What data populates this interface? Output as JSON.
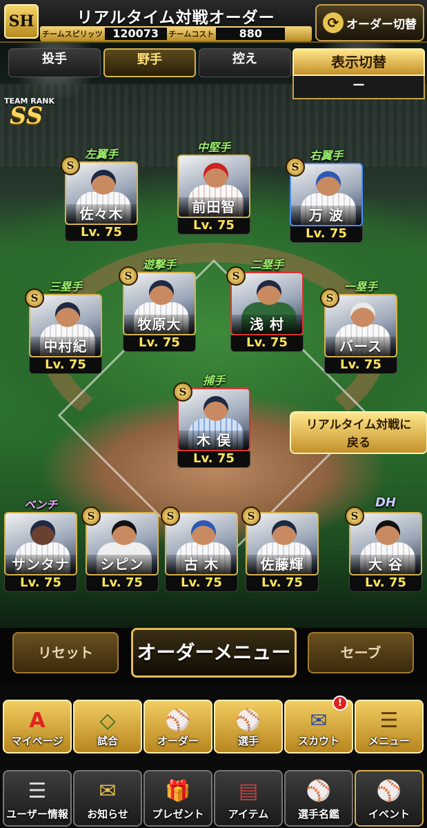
{
  "header": {
    "title": "リアルタイム対戦オーダー",
    "team_logo": "SH",
    "team_spirits_label": "チームスピリッツ",
    "team_spirits_value": "120073",
    "team_cost_label": "チームコスト",
    "team_cost_value": "880",
    "order_switch_label": "オーダー切替"
  },
  "tabs": [
    {
      "label": "投手",
      "active": false
    },
    {
      "label": "野手",
      "active": true
    },
    {
      "label": "控え",
      "active": false
    }
  ],
  "display_switch": {
    "label": "表示切替",
    "value": "ー"
  },
  "team_rank": {
    "label": "TEAM RANK",
    "value": "SS"
  },
  "players": {
    "lf": {
      "position": "左翼手",
      "name": "佐々木",
      "level": "Lv. 75",
      "badge": "S"
    },
    "cf": {
      "position": "中堅手",
      "name": "前田智",
      "level": "Lv. 75",
      "badge": "S"
    },
    "rf": {
      "position": "右翼手",
      "name": "万 波",
      "level": "Lv. 75",
      "badge": "S"
    },
    "ss": {
      "position": "遊撃手",
      "name": "牧原大",
      "level": "Lv. 75",
      "badge": "S"
    },
    "2b": {
      "position": "二塁手",
      "name": "浅 村",
      "level": "Lv. 75",
      "badge": "S"
    },
    "3b": {
      "position": "三塁手",
      "name": "中村紀",
      "level": "Lv. 75",
      "badge": "S"
    },
    "1b": {
      "position": "一塁手",
      "name": "バース",
      "level": "Lv. 75",
      "badge": "S"
    },
    "c": {
      "position": "捕手",
      "name": "木 俣",
      "level": "Lv. 75",
      "badge": "S"
    }
  },
  "bench": {
    "label": "ベンチ",
    "dh_label": "DH",
    "players": [
      {
        "name": "サンタナ",
        "level": "Lv. 75",
        "badge": "S"
      },
      {
        "name": "シピン",
        "level": "Lv. 75",
        "badge": "S"
      },
      {
        "name": "古 木",
        "level": "Lv. 75",
        "badge": "S"
      },
      {
        "name": "佐藤輝",
        "level": "Lv. 75",
        "badge": "S"
      },
      {
        "name": "大 谷",
        "level": "Lv. 75",
        "badge": "S"
      }
    ]
  },
  "return_button": {
    "line1": "リアルタイム対戦に",
    "line2": "戻る"
  },
  "actions": {
    "reset": "リセット",
    "menu": "オーダーメニュー",
    "save": "セーブ"
  },
  "nav_main": [
    {
      "label": "マイページ",
      "icon": "A"
    },
    {
      "label": "試合",
      "icon": "◇"
    },
    {
      "label": "オーダー",
      "icon": "⚾"
    },
    {
      "label": "選手",
      "icon": "⚾"
    },
    {
      "label": "スカウト",
      "icon": "✉",
      "alert": "!"
    },
    {
      "label": "メニュー",
      "icon": "☰"
    }
  ],
  "nav_sub": [
    {
      "label": "ユーザー情報",
      "icon": "☰"
    },
    {
      "label": "お知らせ",
      "icon": "✉"
    },
    {
      "label": "プレゼント",
      "icon": "🎁"
    },
    {
      "label": "アイテム",
      "icon": "▤"
    },
    {
      "label": "選手名鑑",
      "icon": "⚾"
    },
    {
      "label": "イベント",
      "icon": "⚾"
    }
  ]
}
